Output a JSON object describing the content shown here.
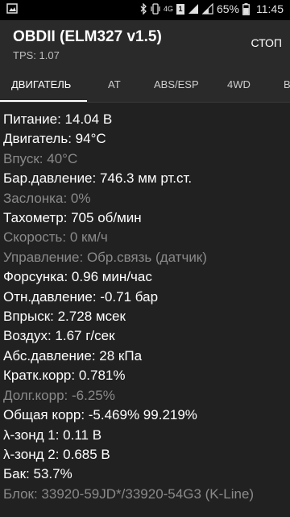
{
  "status_bar": {
    "network": "4G",
    "sim": "1",
    "battery_percent": "65%",
    "time": "11:45"
  },
  "app_bar": {
    "title": "OBDII (ELM327 v1.5)",
    "subtitle": "TPS: 1.07",
    "stop_label": "СТОП"
  },
  "tabs": [
    {
      "label": "ДВИГАТЕЛЬ",
      "active": true
    },
    {
      "label": "AT",
      "active": false
    },
    {
      "label": "ABS/ESP",
      "active": false
    },
    {
      "label": "4WD",
      "active": false
    },
    {
      "label": "В",
      "active": false
    }
  ],
  "readings": [
    {
      "text": "Питание: 14.04 В",
      "dim": false
    },
    {
      "text": "Двигатель: 94°C",
      "dim": false
    },
    {
      "text": "Впуск: 40°C",
      "dim": true
    },
    {
      "text": "Бар.давление: 746.3 мм рт.ст.",
      "dim": false
    },
    {
      "text": "Заслонка: 0%",
      "dim": true
    },
    {
      "text": "Тахометр: 705 об/мин",
      "dim": false
    },
    {
      "text": "Скорость: 0 км/ч",
      "dim": true
    },
    {
      "text": "Управление: Обр.связь (датчик)",
      "dim": true
    },
    {
      "text": "Форсунка: 0.96 мин/час",
      "dim": false
    },
    {
      "text": "Отн.давление: -0.71 бар",
      "dim": false
    },
    {
      "text": "Впрыск: 2.728 мсек",
      "dim": false
    },
    {
      "text": "Воздух: 1.67 г/сек",
      "dim": false
    },
    {
      "text": "Абс.давление: 28 кПа",
      "dim": false
    },
    {
      "text": "Кратк.корр: 0.781%",
      "dim": false
    },
    {
      "text": "Долг.корр: -6.25%",
      "dim": true
    },
    {
      "text": "Общая корр: -5.469%  99.219%",
      "dim": false
    },
    {
      "text": "λ-зонд 1: 0.11 В",
      "dim": false
    },
    {
      "text": "λ-зонд 2: 0.685 В",
      "dim": false
    },
    {
      "text": "Бак: 53.7%",
      "dim": false
    },
    {
      "text": "Блок: 33920-59JD*/33920-54G3 (K-Line)",
      "dim": true
    }
  ]
}
